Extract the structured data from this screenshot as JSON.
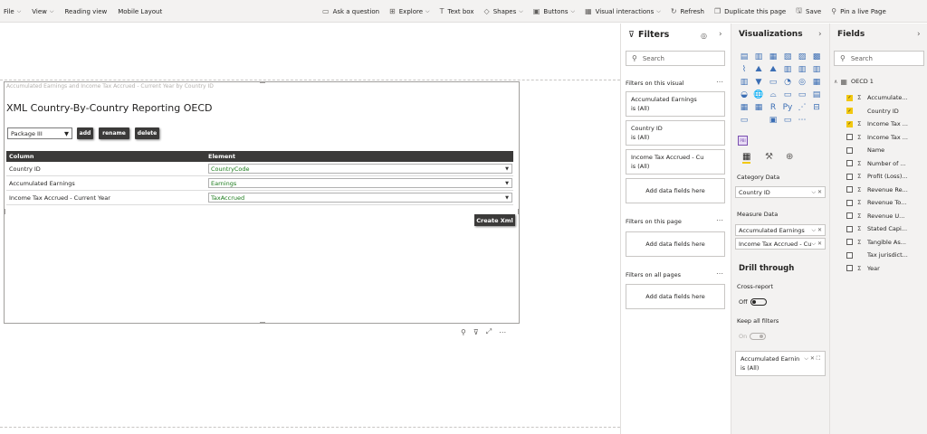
{
  "menu": {
    "left": [
      {
        "label": "File",
        "has_dropdown": true
      },
      {
        "label": "View",
        "has_dropdown": true
      },
      {
        "label": "Reading view",
        "has_dropdown": false
      },
      {
        "label": "Mobile Layout",
        "has_dropdown": false
      }
    ],
    "right": [
      {
        "label": "Ask a question",
        "icon": "chat-icon",
        "glyph": "▭",
        "has_dropdown": false
      },
      {
        "label": "Explore",
        "icon": "explore-icon",
        "glyph": "⊞",
        "has_dropdown": true
      },
      {
        "label": "Text box",
        "icon": "textbox-icon",
        "glyph": "T",
        "has_dropdown": false
      },
      {
        "label": "Shapes",
        "icon": "shapes-icon",
        "glyph": "◇",
        "has_dropdown": true
      },
      {
        "label": "Buttons",
        "icon": "buttons-icon",
        "glyph": "▣",
        "has_dropdown": true
      },
      {
        "label": "Visual interactions",
        "icon": "interactions-icon",
        "glyph": "▦",
        "has_dropdown": true
      },
      {
        "label": "Refresh",
        "icon": "refresh-icon",
        "glyph": "↻",
        "has_dropdown": false
      },
      {
        "label": "Duplicate this page",
        "icon": "duplicate-icon",
        "glyph": "❐",
        "has_dropdown": false
      },
      {
        "label": "Save",
        "icon": "save-icon",
        "glyph": "🖫",
        "has_dropdown": false
      },
      {
        "label": "Pin a live Page",
        "icon": "pin-icon",
        "glyph": "⚲",
        "has_dropdown": false
      }
    ]
  },
  "visual": {
    "subtitle": "Accumulated Earnings and Income Tax Accrued - Current Year by Country ID",
    "title": "XML Country-By-Country Reporting OECD",
    "package_value": "Package III",
    "buttons": {
      "add": "add",
      "rename": "rename",
      "delete": "delete"
    },
    "table": {
      "headers": [
        "Column",
        "Element"
      ],
      "rows": [
        {
          "column": "Country ID",
          "element": "CountryCode"
        },
        {
          "column": "Accumulated Earnings",
          "element": "Earnings"
        },
        {
          "column": "Income Tax Accrued - Current Year",
          "element": "TaxAccrued"
        }
      ]
    },
    "create_label": "Create Xml"
  },
  "filters": {
    "title": "Filters",
    "search_placeholder": "Search",
    "on_visual_label": "Filters on this visual",
    "visual_cards": [
      {
        "name": "Accumulated Earnings",
        "value": "is (All)"
      },
      {
        "name": "Country ID",
        "value": "is (All)"
      },
      {
        "name": "Income Tax Accrued - Cu",
        "value": "is (All)"
      }
    ],
    "add_label": "Add data fields here",
    "on_page_label": "Filters on this page",
    "on_all_label": "Filters on all pages"
  },
  "viz": {
    "title": "Visualizations",
    "icons": [
      "▤",
      "▥",
      "▦",
      "▧",
      "▨",
      "▩",
      "⌇",
      "⛰",
      "⛰",
      "▥",
      "▥",
      "▥",
      "▥",
      "▼",
      "▭",
      "◔",
      "◎",
      "▦",
      "◒",
      "🌐",
      "⌓",
      "▭",
      "▭",
      "▤",
      "▦",
      "▦",
      "R",
      "Py",
      "⋰",
      "⊟",
      "▭",
      "",
      "▣",
      "▭",
      "⋯",
      ""
    ],
    "custom_icon": "PBI",
    "category_label": "Category Data",
    "category_field": "Country ID",
    "measure_label": "Measure Data",
    "measure_fields": [
      "Accumulated Earnings",
      "Income Tax Accrued - Cu"
    ],
    "drill_title": "Drill through",
    "cross_report_label": "Cross-report",
    "cross_report_state": "Off",
    "keep_filters_label": "Keep all filters",
    "keep_filters_state": "On",
    "drill_card": {
      "name": "Accumulated Earnin",
      "value": "is (All)"
    }
  },
  "fields": {
    "title": "Fields",
    "search_placeholder": "Search",
    "table_name": "OECD 1",
    "items": [
      {
        "name": "Accumulate...",
        "checked": true,
        "sigma": true
      },
      {
        "name": "Country ID",
        "checked": true,
        "sigma": false
      },
      {
        "name": "Income Tax ...",
        "checked": true,
        "sigma": true
      },
      {
        "name": "Income Tax ...",
        "checked": false,
        "sigma": true
      },
      {
        "name": "Name",
        "checked": false,
        "sigma": false
      },
      {
        "name": "Number of ...",
        "checked": false,
        "sigma": true
      },
      {
        "name": "Profit (Loss)...",
        "checked": false,
        "sigma": true
      },
      {
        "name": "Revenue Re...",
        "checked": false,
        "sigma": true
      },
      {
        "name": "Revenue To...",
        "checked": false,
        "sigma": true
      },
      {
        "name": "Revenue U...",
        "checked": false,
        "sigma": true
      },
      {
        "name": "Stated Capi...",
        "checked": false,
        "sigma": true
      },
      {
        "name": "Tangible As...",
        "checked": false,
        "sigma": true
      },
      {
        "name": "Tax jurisdict...",
        "checked": false,
        "sigma": false
      },
      {
        "name": "Year",
        "checked": false,
        "sigma": true
      }
    ]
  }
}
